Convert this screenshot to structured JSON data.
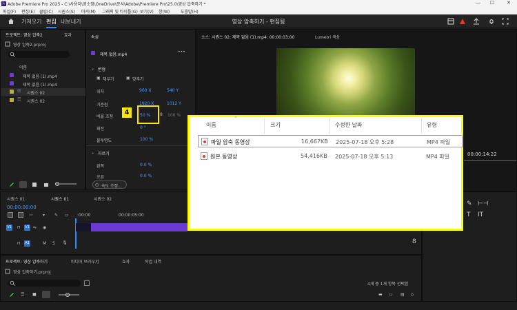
{
  "titlebar": {
    "title": "Adobe Premiere Pro 2025 - C:\\사용자\\영소정\\OneDrive\\문서\\Adobe\\Premiere Pro\\25.0\\영상 압축하기 *",
    "minimize": "—",
    "maximize": "☐",
    "close": "✕"
  },
  "menubar": [
    "파일(F)",
    "편집(E)",
    "클립(C)",
    "시퀀스(S)",
    "마커(M)",
    "그래픽 및 타이틀(G)",
    "보기(V)",
    "창(W)",
    "도움말(H)"
  ],
  "header": {
    "tabs": [
      "가져오기",
      "편집",
      "내보내기"
    ],
    "active_tab": "편집",
    "document_title": "영상 압축하기 - 편집됨"
  },
  "project_panel": {
    "tabs": [
      "프로젝트: 영상 압축2",
      "효과"
    ],
    "filename": "영상 압축2.prproj",
    "column_header": "이름",
    "items": [
      {
        "name": "제목 없음 (1).mp4",
        "type": "video"
      },
      {
        "name": "제목 없음 (1).mp4",
        "type": "video"
      },
      {
        "name": "시퀀스 02",
        "type": "sequence"
      },
      {
        "name": "시퀀스 02",
        "type": "sequence"
      }
    ]
  },
  "properties_panel": {
    "title": "속성",
    "clip_name": "제목 없음.mp4",
    "section_transform": "변형",
    "fill_label": "채우기",
    "fit_label": "맞추기",
    "position_label": "위치",
    "position_x": "960 X",
    "position_y": "540 Y",
    "anchor_label": "기준점",
    "anchor_x": "1920 X",
    "anchor_y": "1012 Y",
    "scale_label": "비율 조정",
    "scale_value": "50 %",
    "scale_value2": "100 %",
    "rotation_label": "회전",
    "rotation_value": "0 °",
    "opacity_label": "불투명도",
    "opacity_value": "100 %",
    "section_crop": "자르기",
    "crop_left_label": "왼쪽",
    "crop_left_value": "0.0 %",
    "crop_right_label": "오른",
    "crop_right_value": "0.0 %",
    "speed_button": "속도 조정..."
  },
  "program_monitor": {
    "tabs": [
      "소스: 시퀀스 02: 제목 없음 (1).mp4: 00:00:03:00",
      "Lumetri 색상"
    ],
    "timecode": "00:00:14:22"
  },
  "timeline_panel": {
    "tabs": [
      "시퀀스 01",
      "시퀀스 01",
      "시퀀스 02"
    ],
    "timecode": "00:00:00:00",
    "ruler_start": ":00:00",
    "ruler_mid": "00:00:05:00",
    "v1": "V1",
    "a1": "A1",
    "track_letters": [
      "M",
      "S"
    ]
  },
  "bottom_project": {
    "tabs": [
      "프로젝트: 영상 압축하기",
      "미디어 브라우저",
      "효과",
      "작업 내역"
    ],
    "filename": "영상 압축하기.prproj",
    "status": "4개 중 1개 항목 선택함"
  },
  "explorer": {
    "headers": [
      "이름",
      "크기",
      "수정한 날짜",
      "유형"
    ],
    "rows": [
      {
        "name": "파일 압축 동영상",
        "size": "16,667KB",
        "date": "2025-07-18 오후 5:28",
        "type": "MP4 파일",
        "selected": true
      },
      {
        "name": "원본 동영상",
        "size": "54,416KB",
        "date": "2025-07-18 오후 5:13",
        "type": "MP4 파일",
        "selected": false
      }
    ]
  },
  "annotation": {
    "badge": "4"
  },
  "colors": {
    "accent": "#2a8cff",
    "highlight": "#ffff00",
    "clip": "#6a3ad0",
    "track": "#2a73c8"
  }
}
